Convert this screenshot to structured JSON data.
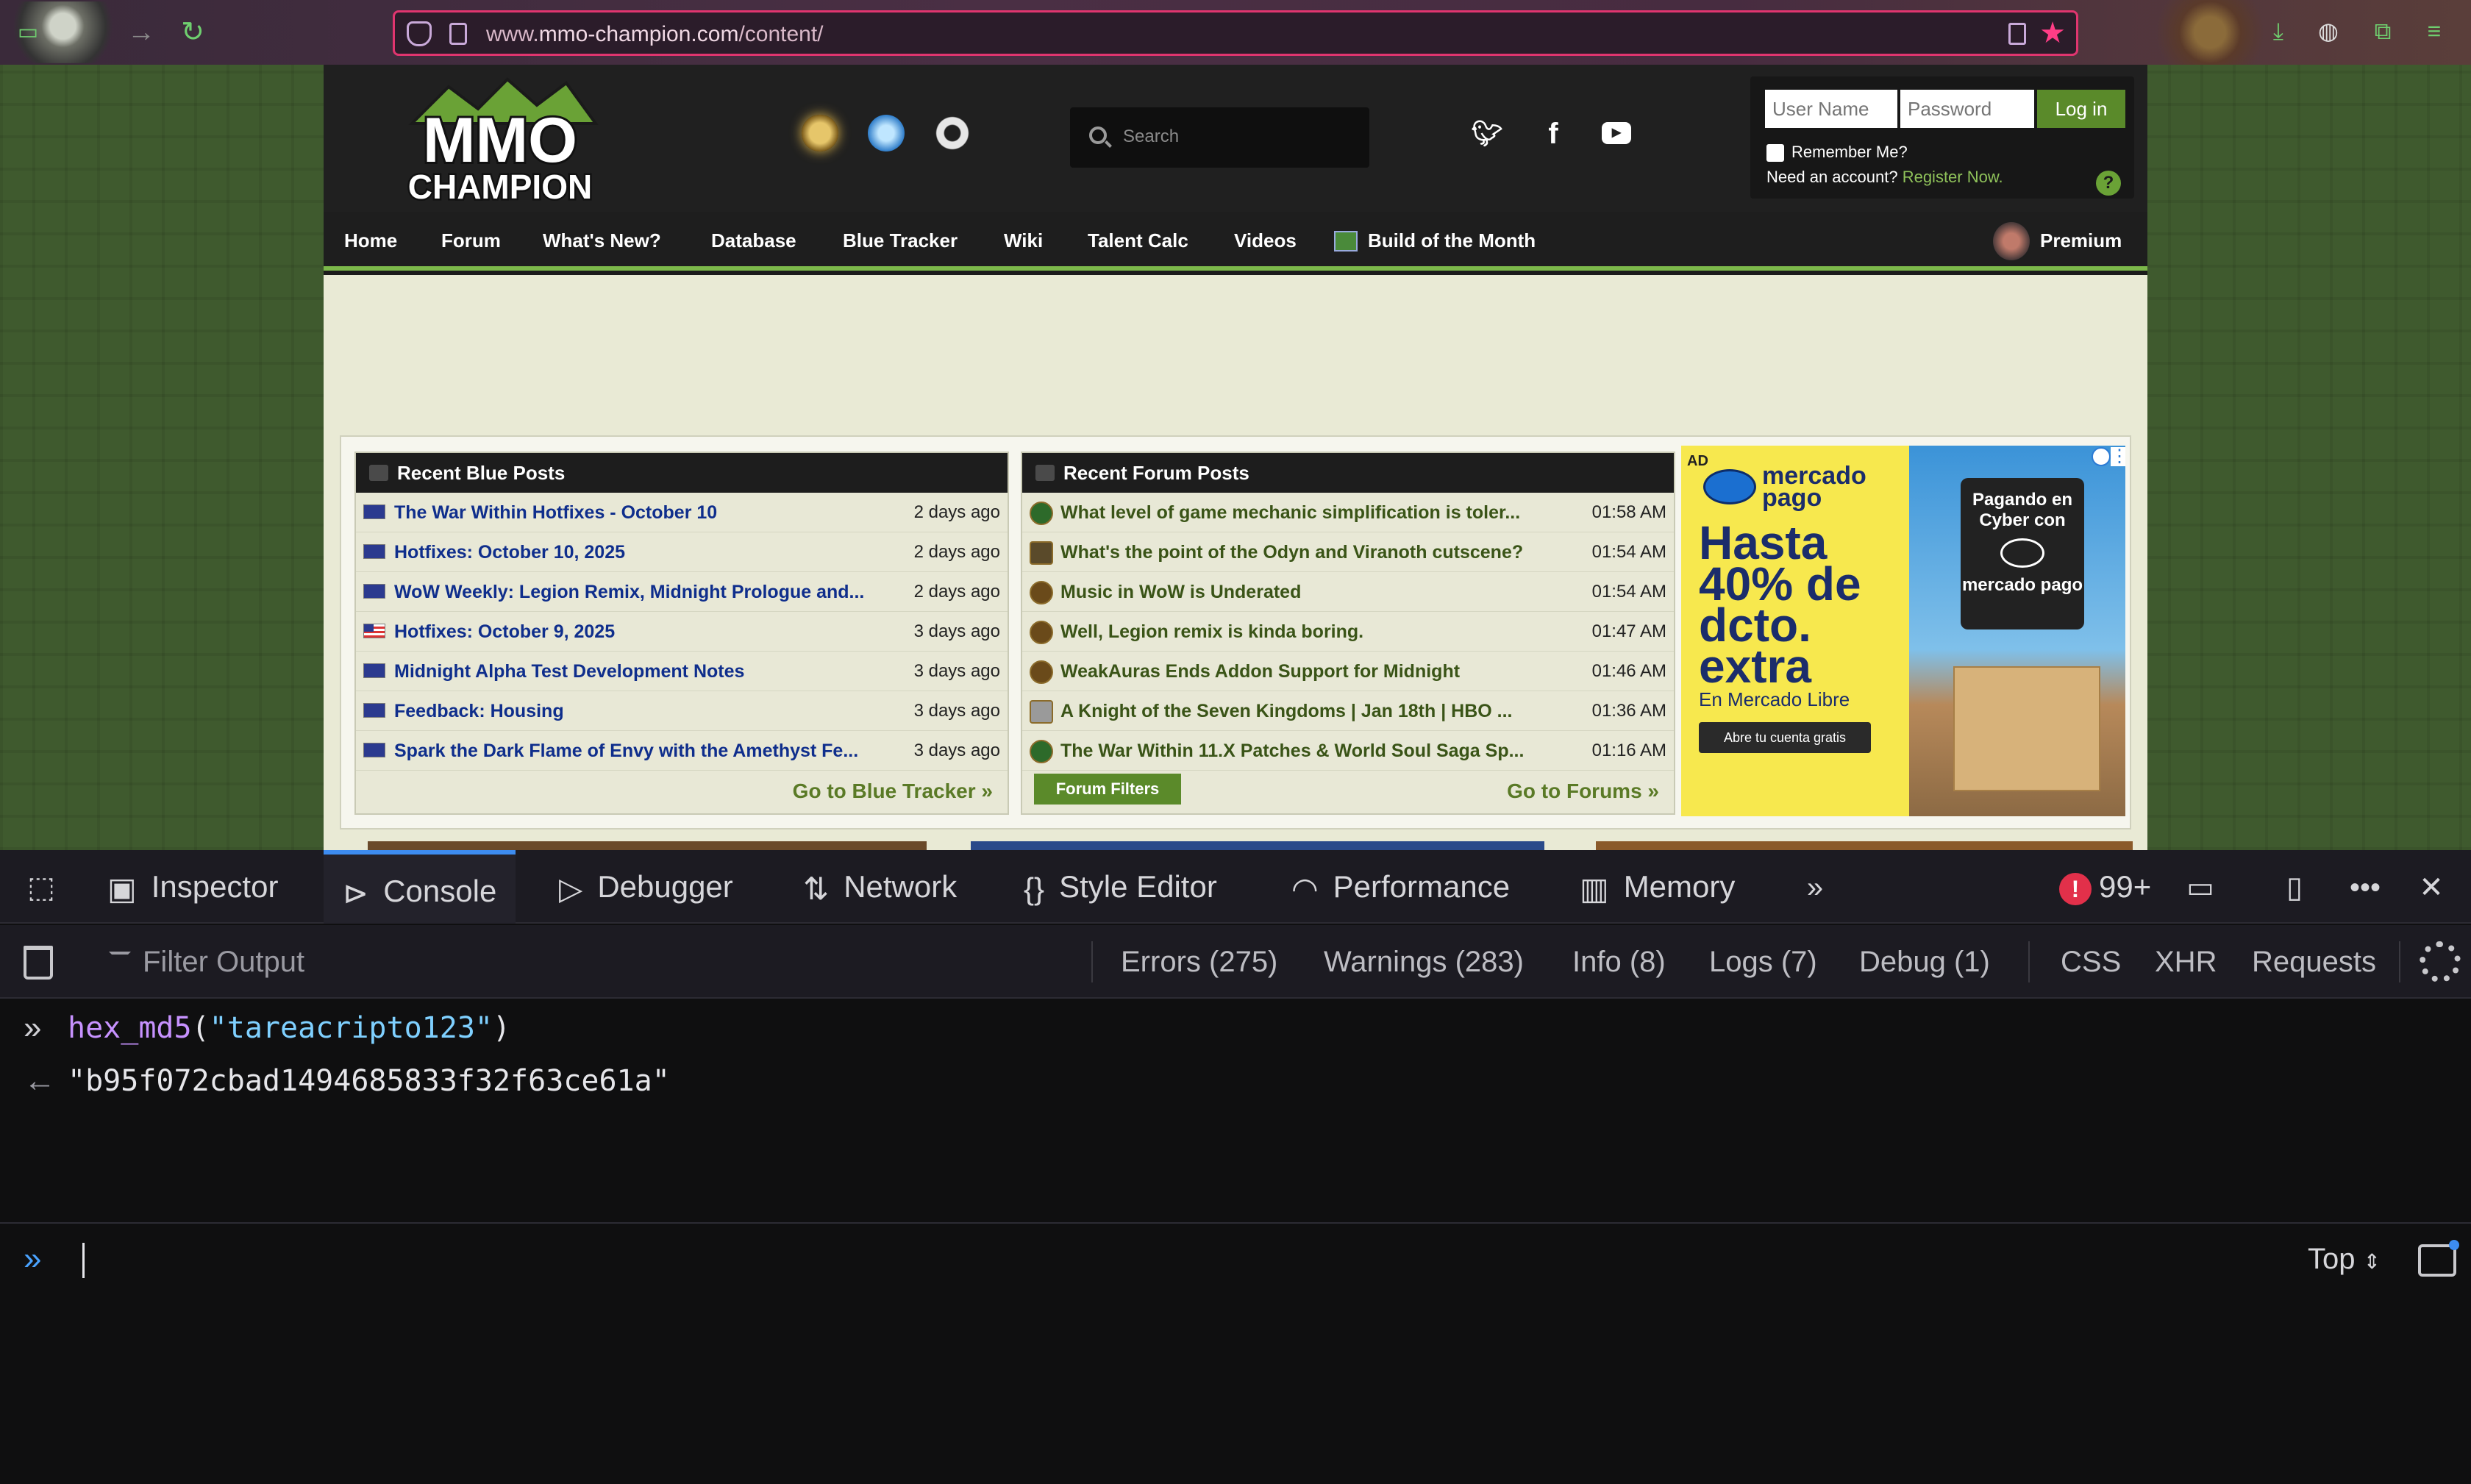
{
  "browser": {
    "url_prefix": "www.",
    "url_domain": "mmo-champion.com",
    "url_path": "/content/"
  },
  "site": {
    "logo_text_1": "MMO",
    "logo_text_2": "CHAMPION",
    "search_placeholder": "Search",
    "login": {
      "username_placeholder": "User Name",
      "password_placeholder": "Password",
      "login_button": "Log in",
      "remember_me": "Remember Me?",
      "need_account": "Need an account?",
      "register_link": "Register Now.",
      "help": "?"
    },
    "nav": [
      "Home",
      "Forum",
      "What's New?",
      "Database",
      "Blue Tracker",
      "Wiki",
      "Talent Calc",
      "Videos",
      "Build of the Month"
    ],
    "premium": "Premium",
    "blue_posts": {
      "title": "Recent Blue Posts",
      "items": [
        {
          "title": "The War Within Hotfixes - October 10",
          "time": "2 days ago",
          "flag": "eu"
        },
        {
          "title": "Hotfixes: October 10, 2025",
          "time": "2 days ago",
          "flag": "eu"
        },
        {
          "title": "WoW Weekly: Legion Remix, Midnight Prologue and...",
          "time": "2 days ago",
          "flag": "eu"
        },
        {
          "title": "Hotfixes: October 9, 2025",
          "time": "3 days ago",
          "flag": "us"
        },
        {
          "title": "Midnight Alpha Test Development Notes",
          "time": "3 days ago",
          "flag": "eu"
        },
        {
          "title": "Feedback: Housing",
          "time": "3 days ago",
          "flag": "eu"
        },
        {
          "title": "Spark the Dark Flame of Envy with the Amethyst Fe...",
          "time": "3 days ago",
          "flag": "eu"
        }
      ],
      "footer_link": "Go to Blue Tracker »"
    },
    "forum_posts": {
      "title": "Recent Forum Posts",
      "items": [
        {
          "title": "What level of game mechanic simplification is toler...",
          "time": "01:58 AM"
        },
        {
          "title": "What's the point of the Odyn and Viranoth cutscene?",
          "time": "01:54 AM"
        },
        {
          "title": "Music in WoW is Underated",
          "time": "01:54 AM"
        },
        {
          "title": "Well, Legion remix is kinda boring.",
          "time": "01:47 AM"
        },
        {
          "title": "WeakAuras Ends Addon Support for Midnight",
          "time": "01:46 AM"
        },
        {
          "title": "A Knight of the Seven Kingdoms | Jan 18th | HBO ...",
          "time": "01:36 AM"
        },
        {
          "title": "The War Within 11.X Patches & World Soul Saga Sp...",
          "time": "01:16 AM"
        }
      ],
      "filters_button": "Forum Filters",
      "footer_link": "Go to Forums »"
    },
    "ad": {
      "label": "AD",
      "brand": "mercado pago",
      "headline": "Hasta 40% de dcto. extra",
      "sub": "En Mercado Libre",
      "cta": "Abre tu cuenta gratis",
      "card_text": "Pagando en Cyber con",
      "card_brand": "mercado pago"
    }
  },
  "devtools": {
    "tabs": [
      "Inspector",
      "Console",
      "Debugger",
      "Network",
      "Style Editor",
      "Performance",
      "Memory"
    ],
    "error_count": "99+",
    "filter_placeholder": "Filter Output",
    "filters": [
      "Errors (275)",
      "Warnings (283)",
      "Info (8)",
      "Logs (7)",
      "Debug (1)",
      "CSS",
      "XHR",
      "Requests"
    ],
    "console": {
      "command_fn": "hex_md5",
      "command_arg": "\"tareacripto123\"",
      "result": "\"b95f072cbad1494685833f32f63ce61a\"",
      "context": "Top"
    }
  }
}
